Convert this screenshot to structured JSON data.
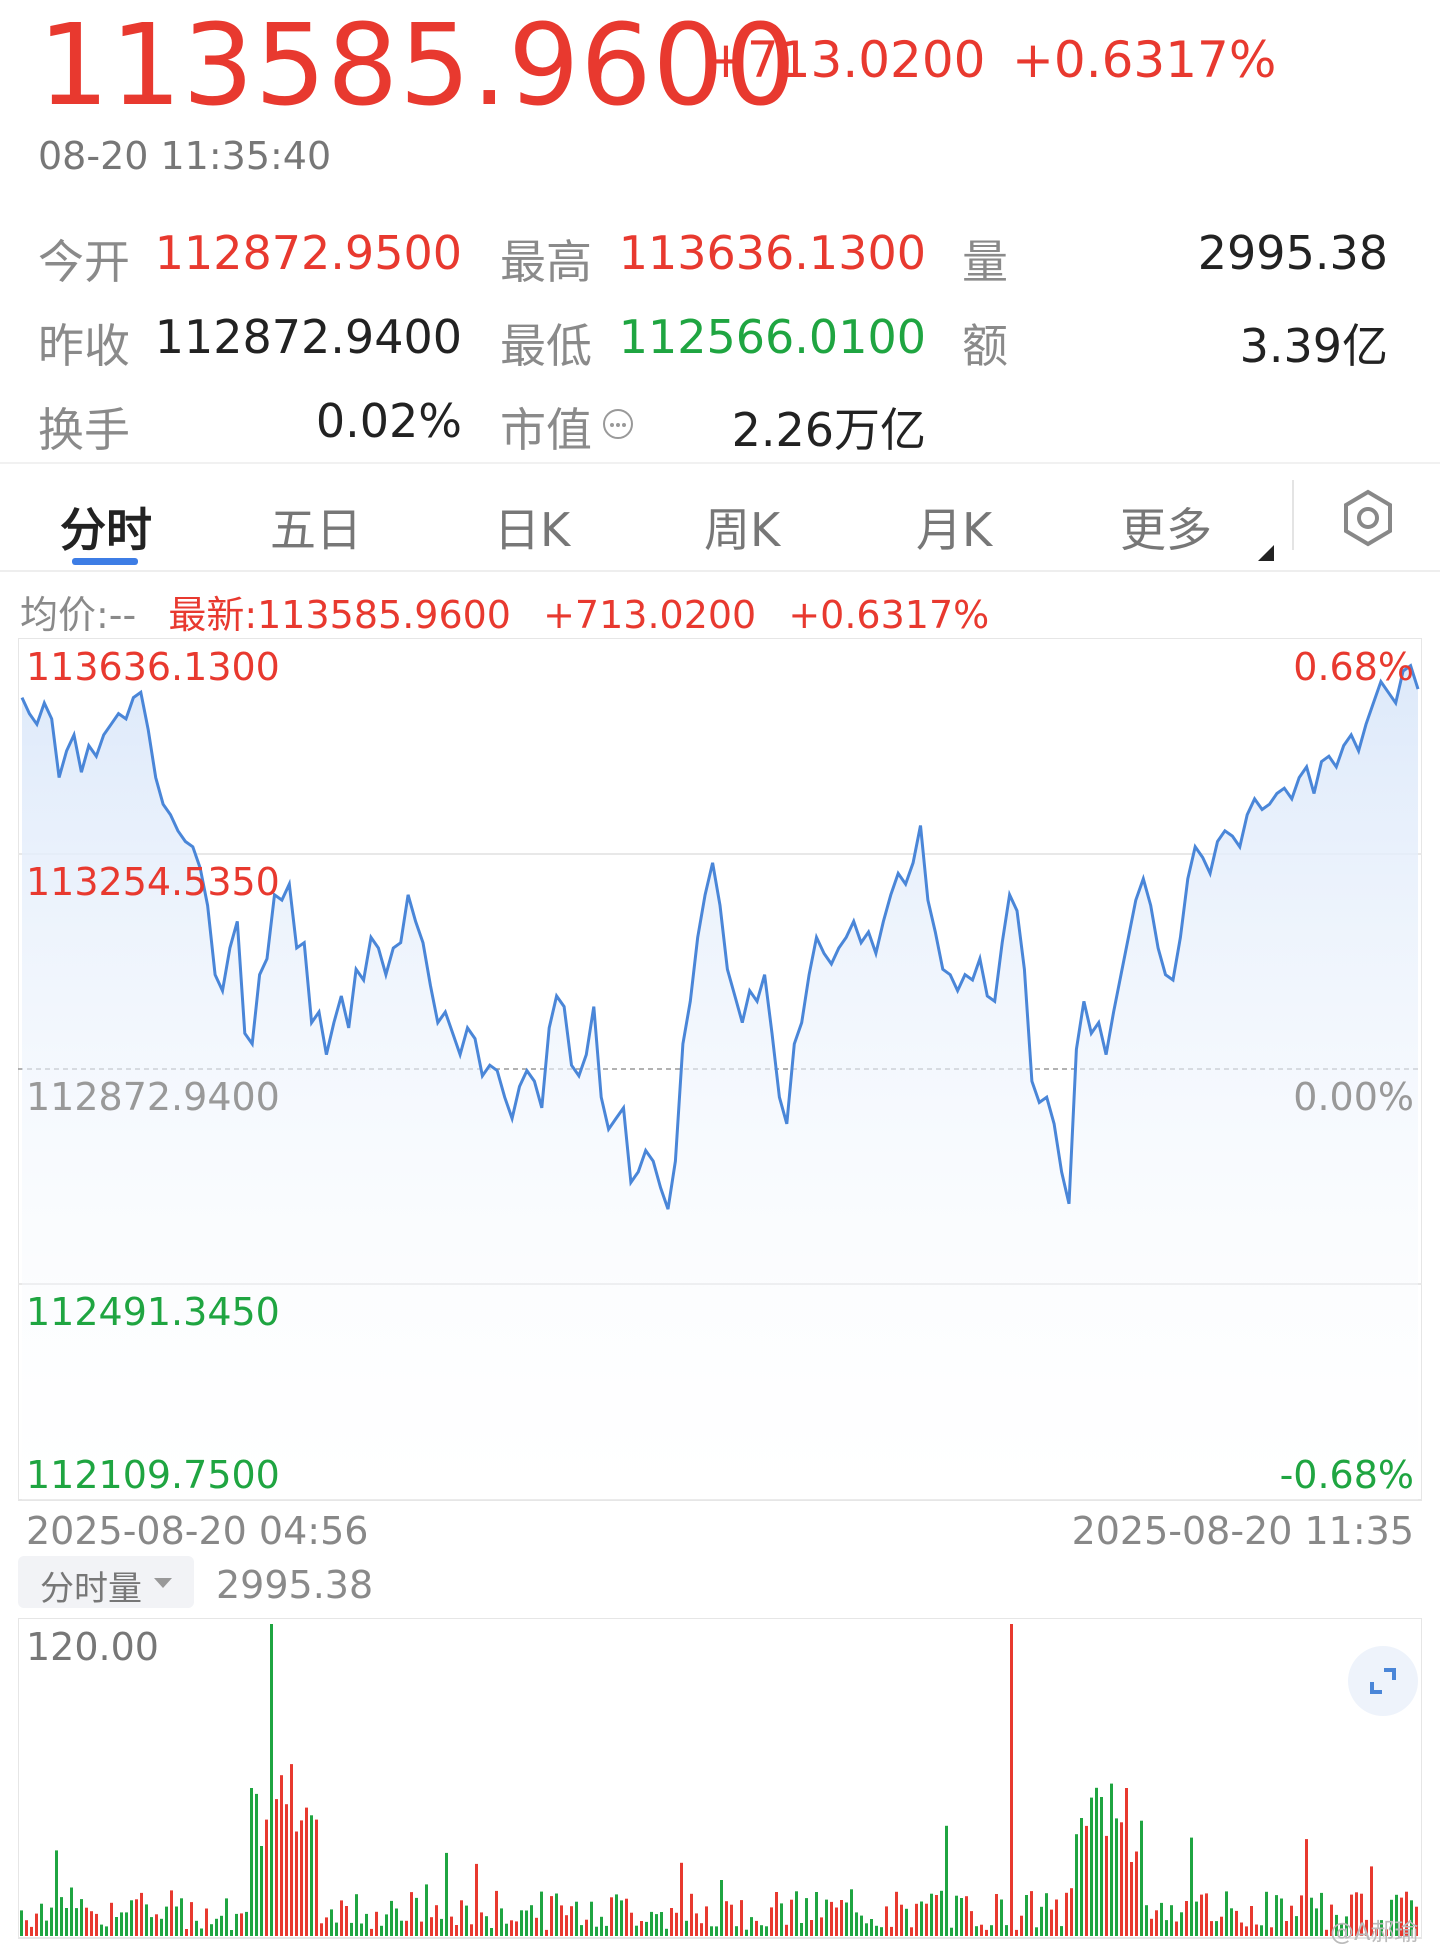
{
  "quote": {
    "price": "113585.9600",
    "change": "+713.0200",
    "change_pct": "+0.6317%",
    "time": "08-20 11:35:40"
  },
  "stats": {
    "open_label": "今开",
    "open": "112872.9500",
    "high_label": "最高",
    "high": "113636.1300",
    "volume_label": "量",
    "volume": "2995.38",
    "prev_close_label": "昨收",
    "prev_close": "112872.9400",
    "low_label": "最低",
    "low": "112566.0100",
    "amount_label": "额",
    "amount": "3.39亿",
    "turnover_label": "换手",
    "turnover": "0.02%",
    "mktcap_label": "市值",
    "mktcap": "2.26万亿"
  },
  "tabs": {
    "items": [
      "分时",
      "五日",
      "日K",
      "周K",
      "月K",
      "更多"
    ],
    "active": "分时"
  },
  "infoline": {
    "avg": "均价:--",
    "latest": "最新:113585.9600",
    "change": "+713.0200",
    "pct": "+0.6317%"
  },
  "price_axis": {
    "top": "113636.1300",
    "upper": "113254.5350",
    "mid": "112872.9400",
    "lower": "112491.3450",
    "bottom": "112109.7500",
    "pct_top": "0.68%",
    "pct_mid": "0.00%",
    "pct_bottom": "-0.68%",
    "time_start": "2025-08-20 04:56",
    "time_end": "2025-08-20 11:35"
  },
  "volume_panel": {
    "label": "分时量",
    "total": "2995.38",
    "axis_max": "120.00"
  },
  "watermark": "@A郝瑜",
  "colors": {
    "up": "#e8392f",
    "down": "#1fa541",
    "line": "#4a86d8",
    "fill": "#e3eefb"
  },
  "chart_data": {
    "type": "line",
    "title": "",
    "xlabel": "",
    "ylabel": "",
    "x_range": [
      "2025-08-20 04:56",
      "2025-08-20 11:35"
    ],
    "ylim": [
      112109.75,
      113636.13
    ],
    "baseline": 112872.94,
    "series": [
      {
        "values": [
          113570,
          113540,
          113520,
          113560,
          113530,
          113420,
          113470,
          113500,
          113430,
          113480,
          113460,
          113500,
          113520,
          113540,
          113530,
          113570,
          113580,
          113510,
          113420,
          113370,
          113350,
          113320,
          113300,
          113290,
          113250,
          113180,
          113050,
          113020,
          113100,
          113150,
          112940,
          112920,
          113050,
          113080,
          113200,
          113190,
          113220,
          113100,
          113110,
          112960,
          112980,
          112900,
          112960,
          113010,
          112950,
          113060,
          113040,
          113120,
          113100,
          113050,
          113100,
          113110,
          113200,
          113150,
          113110,
          113030,
          112960,
          112980,
          112940,
          112900,
          112950,
          112930,
          112860,
          112880,
          112870,
          112820,
          112780,
          112840,
          112870,
          112850,
          112800,
          112950,
          113010,
          112990,
          112880,
          112860,
          112900,
          112990,
          112820,
          112760,
          112780,
          112800,
          112660,
          112680,
          112720,
          112700,
          112650,
          112610,
          112700,
          112920,
          113000,
          113120,
          113200,
          113260,
          113180,
          113060,
          113010,
          112960,
          113020,
          113000,
          113050,
          112940,
          112820,
          112770,
          112920,
          112960,
          113050,
          113120,
          113090,
          113070,
          113100,
          113120,
          113150,
          113110,
          113130,
          113090,
          113150,
          113200,
          113240,
          113220,
          113260,
          113330,
          113190,
          113130,
          113060,
          113050,
          113020,
          113050,
          113040,
          113080,
          113010,
          113000,
          113110,
          113200,
          113170,
          113060,
          112850,
          112810,
          112820,
          112770,
          112680,
          112620,
          112910,
          113000,
          112940,
          112960,
          112900,
          112980,
          113050,
          113120,
          113190,
          113230,
          113180,
          113100,
          113050,
          113040,
          113120,
          113230,
          113290,
          113270,
          113240,
          113300,
          113320,
          113310,
          113290,
          113350,
          113380,
          113360,
          113370,
          113390,
          113400,
          113380,
          113420,
          113440,
          113390,
          113450,
          113460,
          113440,
          113480,
          113500,
          113470,
          113520,
          113560,
          113600,
          113580,
          113560,
          113620,
          113630,
          113586
        ]
      }
    ]
  }
}
